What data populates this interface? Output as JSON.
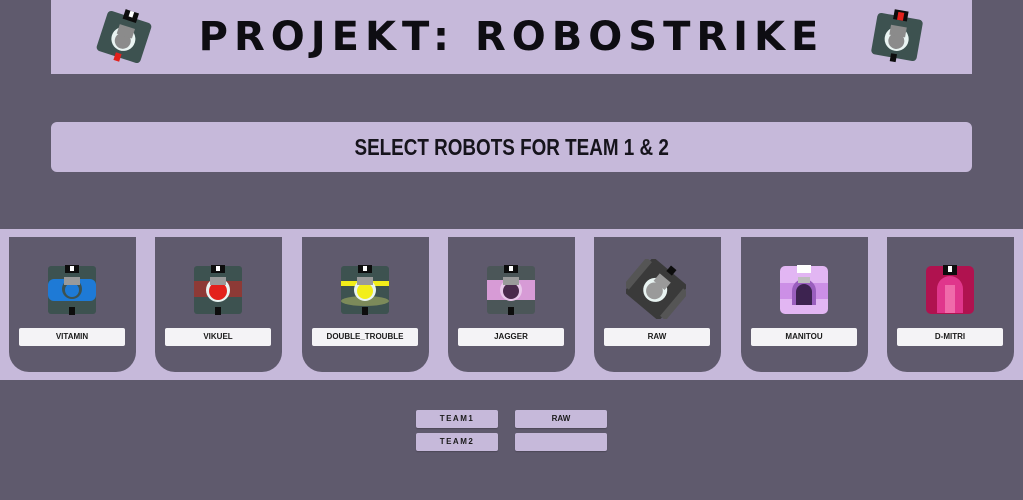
{
  "header": {
    "title": "PROJEKT: ROBOSTRIKE"
  },
  "prompt": "SELECT ROBOTS FOR TEAM 1 & 2",
  "robots": [
    {
      "name": "VITAMIN",
      "color": "#1e7ad6",
      "icon": "blue-robot-icon"
    },
    {
      "name": "VIKUEL",
      "color": "#e3211c",
      "icon": "red-robot-icon"
    },
    {
      "name": "DOUBLE_TROUBLE",
      "color": "#f2ee1a",
      "icon": "yellow-robot-icon"
    },
    {
      "name": "JAGGER",
      "color": "#d79bd6",
      "icon": "pink-robot-icon"
    },
    {
      "name": "RAW",
      "color": "#9a9a9a",
      "icon": "grey-robot-icon"
    },
    {
      "name": "MANITOU",
      "color": "#cc8fe6",
      "icon": "lilac-robot-icon"
    },
    {
      "name": "D-MITRI",
      "color": "#e0368c",
      "icon": "magenta-robot-icon"
    }
  ],
  "teams": {
    "team1_label": "TEAM1",
    "team2_label": "TEAM2",
    "team1_value": "RAW",
    "team2_value": ""
  }
}
